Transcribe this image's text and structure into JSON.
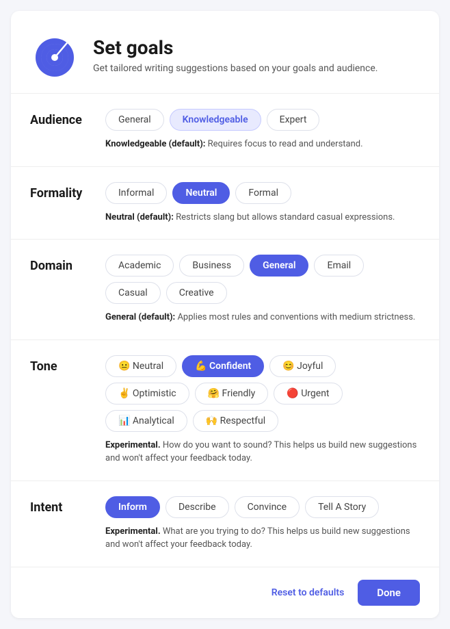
{
  "header": {
    "title": "Set goals",
    "subtitle": "Get tailored writing suggestions based on your goals and audience."
  },
  "sections": {
    "audience": {
      "label": "Audience",
      "options": [
        "General",
        "Knowledgeable",
        "Expert"
      ],
      "active": "Knowledgeable",
      "description_bold": "Knowledgeable (default):",
      "description": " Requires focus to read and understand."
    },
    "formality": {
      "label": "Formality",
      "options": [
        "Informal",
        "Neutral",
        "Formal"
      ],
      "active": "Neutral",
      "description_bold": "Neutral (default):",
      "description": " Restricts slang but allows standard casual expressions."
    },
    "domain": {
      "label": "Domain",
      "options": [
        "Academic",
        "Business",
        "General",
        "Email",
        "Casual",
        "Creative"
      ],
      "active": "General",
      "description_bold": "General (default):",
      "description": " Applies most rules and conventions with medium strictness."
    },
    "tone": {
      "label": "Tone",
      "options": [
        {
          "label": "Neutral",
          "emoji": "😐"
        },
        {
          "label": "Confident",
          "emoji": "💪"
        },
        {
          "label": "Joyful",
          "emoji": "😊"
        },
        {
          "label": "Optimistic",
          "emoji": "✌️"
        },
        {
          "label": "Friendly",
          "emoji": "🤗"
        },
        {
          "label": "Urgent",
          "emoji": "🔴"
        },
        {
          "label": "Analytical",
          "emoji": "📊"
        },
        {
          "label": "Respectful",
          "emoji": "🙌"
        }
      ],
      "active": "Confident",
      "description_bold": "Experimental.",
      "description": " How do you want to sound? This helps us build new suggestions and won't affect your feedback today."
    },
    "intent": {
      "label": "Intent",
      "options": [
        "Inform",
        "Describe",
        "Convince",
        "Tell A Story"
      ],
      "active": "Inform",
      "description_bold": "Experimental.",
      "description": " What are you trying to do? This helps us build new suggestions and won't affect your feedback today."
    }
  },
  "footer": {
    "reset_label": "Reset to defaults",
    "done_label": "Done"
  }
}
